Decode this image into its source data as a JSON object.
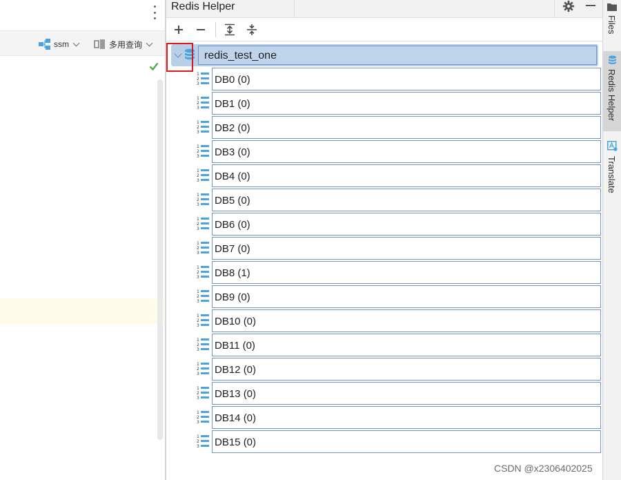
{
  "left_toolbar": {
    "ssm_label": "ssm",
    "query_label": "多用查询"
  },
  "panel": {
    "title": "Redis Helper"
  },
  "toolbar": {
    "add": "add-icon",
    "remove": "remove-icon",
    "expand_all": "expand-all-icon",
    "collapse_all": "collapse-all-icon"
  },
  "tree": {
    "root_label": "redis_test_one",
    "databases": [
      "DB0 (0)",
      "DB1 (0)",
      "DB2 (0)",
      "DB3 (0)",
      "DB4 (0)",
      "DB5 (0)",
      "DB6 (0)",
      "DB7 (0)",
      "DB8 (1)",
      "DB9 (0)",
      "DB10 (0)",
      "DB11 (0)",
      "DB12 (0)",
      "DB13 (0)",
      "DB14 (0)",
      "DB15 (0)"
    ]
  },
  "side_strip": {
    "files": "Files",
    "redis_helper": "Redis Helper",
    "translate": "Translate"
  },
  "watermark": "CSDN @x2306402025",
  "colors": {
    "selection": "#b8cfe6",
    "accent_blue": "#4aa3df",
    "highlight_box": "#e0161e",
    "check_green": "#4caf50"
  }
}
